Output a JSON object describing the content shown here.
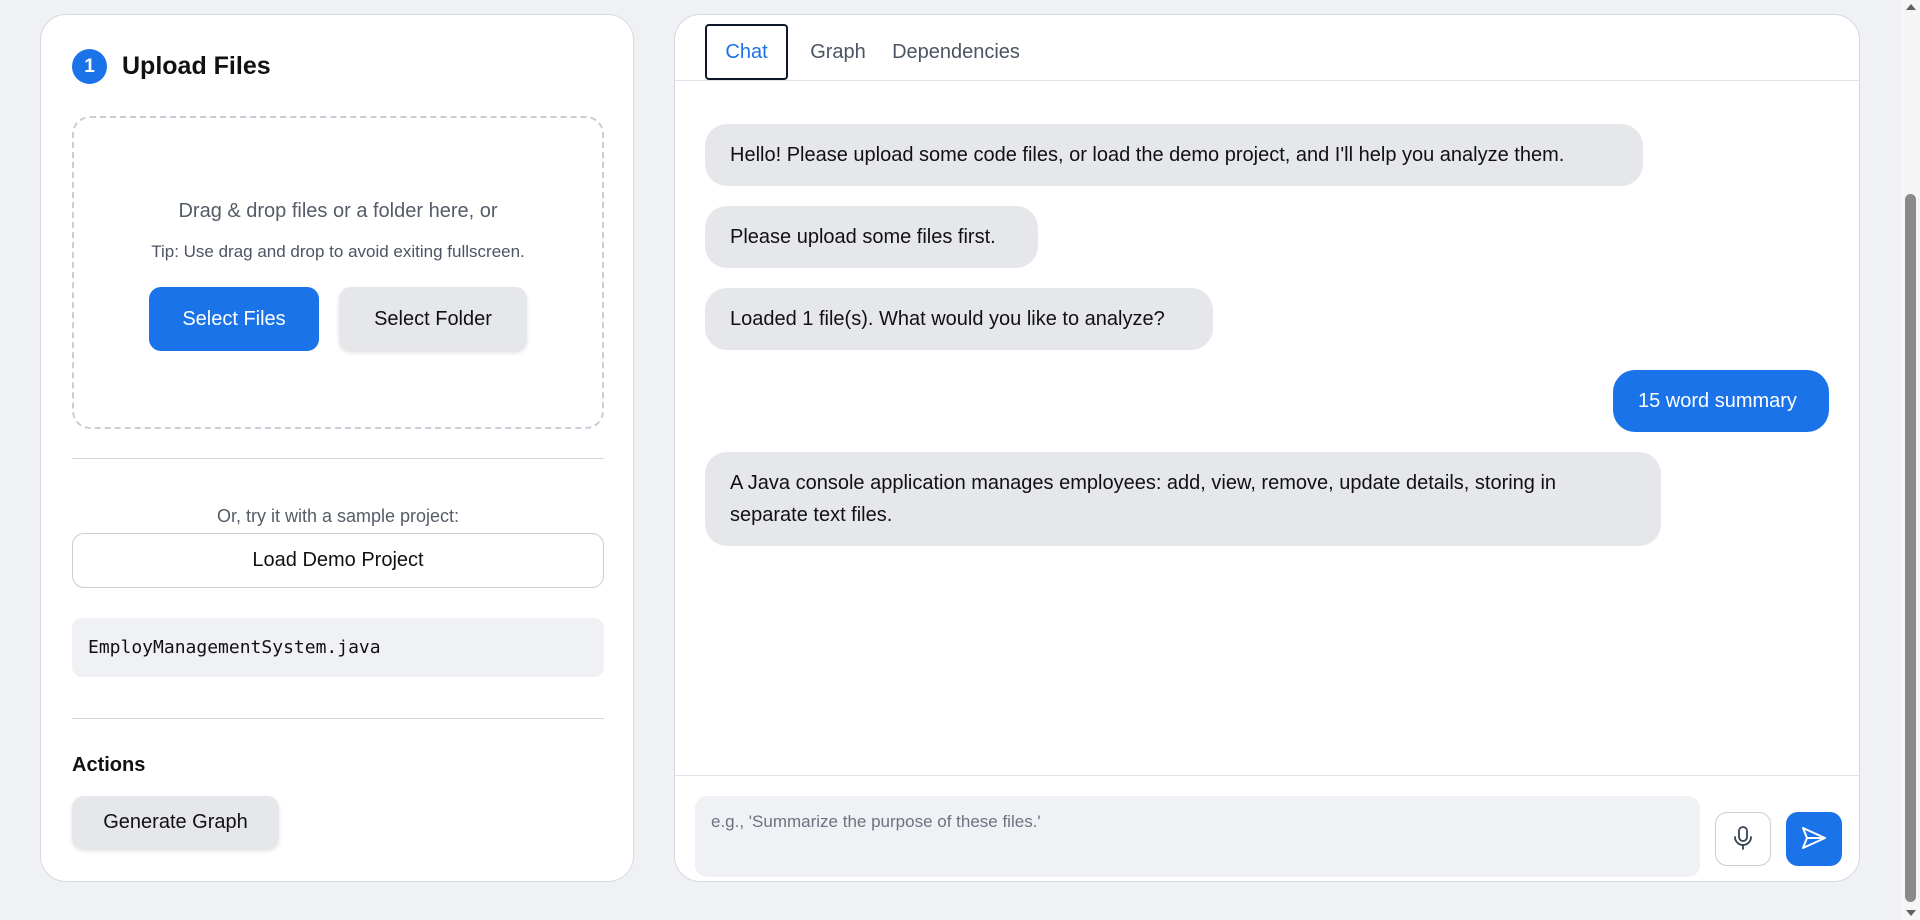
{
  "upload": {
    "step": "1",
    "title": "Upload Files",
    "dropzone_text": "Drag & drop files or a folder here, or",
    "tip": "Tip: Use drag and drop to avoid exiting fullscreen.",
    "select_files_label": "Select Files",
    "select_folder_label": "Select Folder",
    "sample_text": "Or, try it with a sample project:",
    "load_demo_label": "Load Demo Project",
    "files": [
      "EmployManagementSystem.java"
    ],
    "actions_title": "Actions",
    "generate_graph_label": "Generate Graph"
  },
  "tabs": [
    {
      "label": "Chat",
      "active": true
    },
    {
      "label": "Graph",
      "active": false
    },
    {
      "label": "Dependencies",
      "active": false
    }
  ],
  "messages": [
    {
      "role": "bot",
      "text": "Hello! Please upload some code files, or load the demo project, and I'll help you analyze them."
    },
    {
      "role": "bot",
      "text": "Please upload some files first."
    },
    {
      "role": "bot",
      "text": "Loaded 1 file(s). What would you like to analyze?"
    },
    {
      "role": "user",
      "text": "15 word summary"
    },
    {
      "role": "bot",
      "text": "A Java console application manages employees: add, view, remove, update details, storing in separate text files."
    }
  ],
  "chat_input": {
    "placeholder": "e.g., 'Summarize the purpose of these files.'",
    "value": ""
  },
  "icons": {
    "mic": "microphone-icon",
    "send": "send-icon"
  },
  "colors": {
    "accent": "#1a73e8",
    "bot_bubble": "#e5e7eb",
    "user_bubble": "#1a73e8",
    "background": "#f0f1f5"
  }
}
